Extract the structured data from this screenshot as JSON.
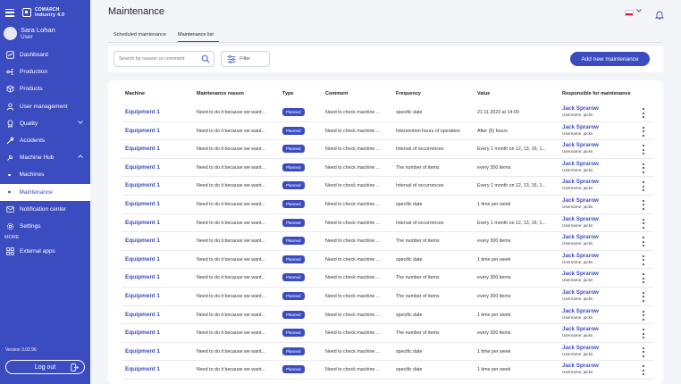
{
  "brand": {
    "line1": "COMARCH",
    "line2": "Industry 4.0"
  },
  "user": {
    "name": "Sara Lohan",
    "role": "User"
  },
  "nav": [
    {
      "label": "Dashboard",
      "icon": "dashboard-icon"
    },
    {
      "label": "Production",
      "icon": "production-icon"
    },
    {
      "label": "Products",
      "icon": "products-icon"
    },
    {
      "label": "User management",
      "icon": "user-icon"
    },
    {
      "label": "Quality",
      "icon": "quality-icon",
      "expandable": true
    },
    {
      "label": "Accidents",
      "icon": "accidents-icon"
    },
    {
      "label": "Machine Hub",
      "icon": "machine-hub-icon",
      "expanded": true
    },
    {
      "label": "Machines",
      "sub": true
    },
    {
      "label": "Maintenance",
      "sub": true,
      "active": true
    },
    {
      "label": "Notification center",
      "icon": "notification-icon"
    },
    {
      "label": "Settings",
      "icon": "gear-icon"
    }
  ],
  "more_label": "MORE",
  "external_apps": "External apps",
  "version": "Version 3.02.96",
  "logout": "Log out",
  "page_title": "Maintenance",
  "tabs": [
    "Scheduled maintenance",
    "Maintenance list"
  ],
  "search_placeholder": "Search by reason or comment",
  "filter_label": "Filter",
  "add_button": "Add new maintenance",
  "colors": {
    "primary": "#3b4cc0",
    "background": "#f4f5f9"
  },
  "columns": [
    "Machine",
    "Maintenance reason",
    "Type",
    "Comment",
    "Frequency",
    "Value",
    "Responsible for maintenance"
  ],
  "rows": [
    {
      "machine": "Equipment 1",
      "reason": "Need to do it because we want...",
      "type": "Planned",
      "comment": "Need to check machine ...",
      "frequency": "specific date",
      "value": "21.11.2023 at 14:00",
      "resp_name": "Jack Sprarow",
      "resp_user": "Username: jacks"
    },
    {
      "machine": "Equipment 1",
      "reason": "Need to do it because we want...",
      "type": "Planned",
      "comment": "Need to check machine ...",
      "frequency": "Intervention hours of operation",
      "value": "After (5) hours",
      "resp_name": "Jack Sprarow",
      "resp_user": "Username: jacks"
    },
    {
      "machine": "Equipment 1",
      "reason": "Need to do it because we want...",
      "type": "Planned",
      "comment": "Need to check machine ...",
      "frequency": "Interval of occurrences",
      "value": "Every 1 month on 12, 13, 16, 1...",
      "resp_name": "Jack Sprarow",
      "resp_user": "Username: jacks"
    },
    {
      "machine": "Equipment 1",
      "reason": "Need to do it because we want...",
      "type": "Planned",
      "comment": "Need to check machine ...",
      "frequency": "The number of items",
      "value": "every 300 items",
      "resp_name": "Jack Sprarow",
      "resp_user": "Username: jacks"
    },
    {
      "machine": "Equipment 1",
      "reason": "Need to do it because we want...",
      "type": "Planned",
      "comment": "Need to check machine ...",
      "frequency": "Interval of occurrences",
      "value": "Every 1 month on 12, 13, 16, 1...",
      "resp_name": "Jack Sprarow",
      "resp_user": "Username: jacks"
    },
    {
      "machine": "Equipment 1",
      "reason": "Need to do it because we want...",
      "type": "Planned",
      "comment": "Need to check machine ...",
      "frequency": "specific date",
      "value": "1 time per week",
      "resp_name": "Jack Sprarow",
      "resp_user": "Username: jacks"
    },
    {
      "machine": "Equipment 1",
      "reason": "Need to do it because we want...",
      "type": "Planned",
      "comment": "Need to check machine ...",
      "frequency": "Interval of occurrences",
      "value": "Every 1 month on 12, 13, 16, 1...",
      "resp_name": "Jack Sprarow",
      "resp_user": "Username: jacks"
    },
    {
      "machine": "Equipment 1",
      "reason": "Need to do it because we want...",
      "type": "Planned",
      "comment": "Need to check machine ...",
      "frequency": "The number of items",
      "value": "every 300 items",
      "resp_name": "Jack Sprarow",
      "resp_user": "Username: jacks"
    },
    {
      "machine": "Equipment 1",
      "reason": "Need to do it because we want...",
      "type": "Planned",
      "comment": "Need to check machine ...",
      "frequency": "specific date",
      "value": "1 time per week",
      "resp_name": "Jack Sprarow",
      "resp_user": "Username: jacks"
    },
    {
      "machine": "Equipment 1",
      "reason": "Need to do it because we want...",
      "type": "Planned",
      "comment": "Need to check machine ...",
      "frequency": "The number of items",
      "value": "every 300 items",
      "resp_name": "Jack Sprarow",
      "resp_user": "Username: jacks"
    },
    {
      "machine": "Equipment 1",
      "reason": "Need to do it because we want...",
      "type": "Planned",
      "comment": "Need to check machine ...",
      "frequency": "The number of items",
      "value": "every 300 items",
      "resp_name": "Jack Sprarow",
      "resp_user": "Username: jacks"
    },
    {
      "machine": "Equipment 1",
      "reason": "Need to do it because we want...",
      "type": "Planned",
      "comment": "Need to check machine ...",
      "frequency": "specific date",
      "value": "1 time per week",
      "resp_name": "Jack Sprarow",
      "resp_user": "Username: jacks"
    },
    {
      "machine": "Equipment 1",
      "reason": "Need to do it because we want...",
      "type": "Planned",
      "comment": "Need to check machine ...",
      "frequency": "The number of items",
      "value": "every 300 items",
      "resp_name": "Jack Sprarow",
      "resp_user": "Username: jacks"
    },
    {
      "machine": "Equipment 1",
      "reason": "Need to do it because we want...",
      "type": "Planned",
      "comment": "Need to check machine ...",
      "frequency": "specific date",
      "value": "1 time per week",
      "resp_name": "Jack Sprarow",
      "resp_user": "Username: jacks"
    },
    {
      "machine": "Equipment 1",
      "reason": "Need to do it because we want...",
      "type": "Planned",
      "comment": "Need to check machine ...",
      "frequency": "specific date",
      "value": "1 time per week",
      "resp_name": "Jack Sprarow",
      "resp_user": "Username: jacks"
    }
  ]
}
